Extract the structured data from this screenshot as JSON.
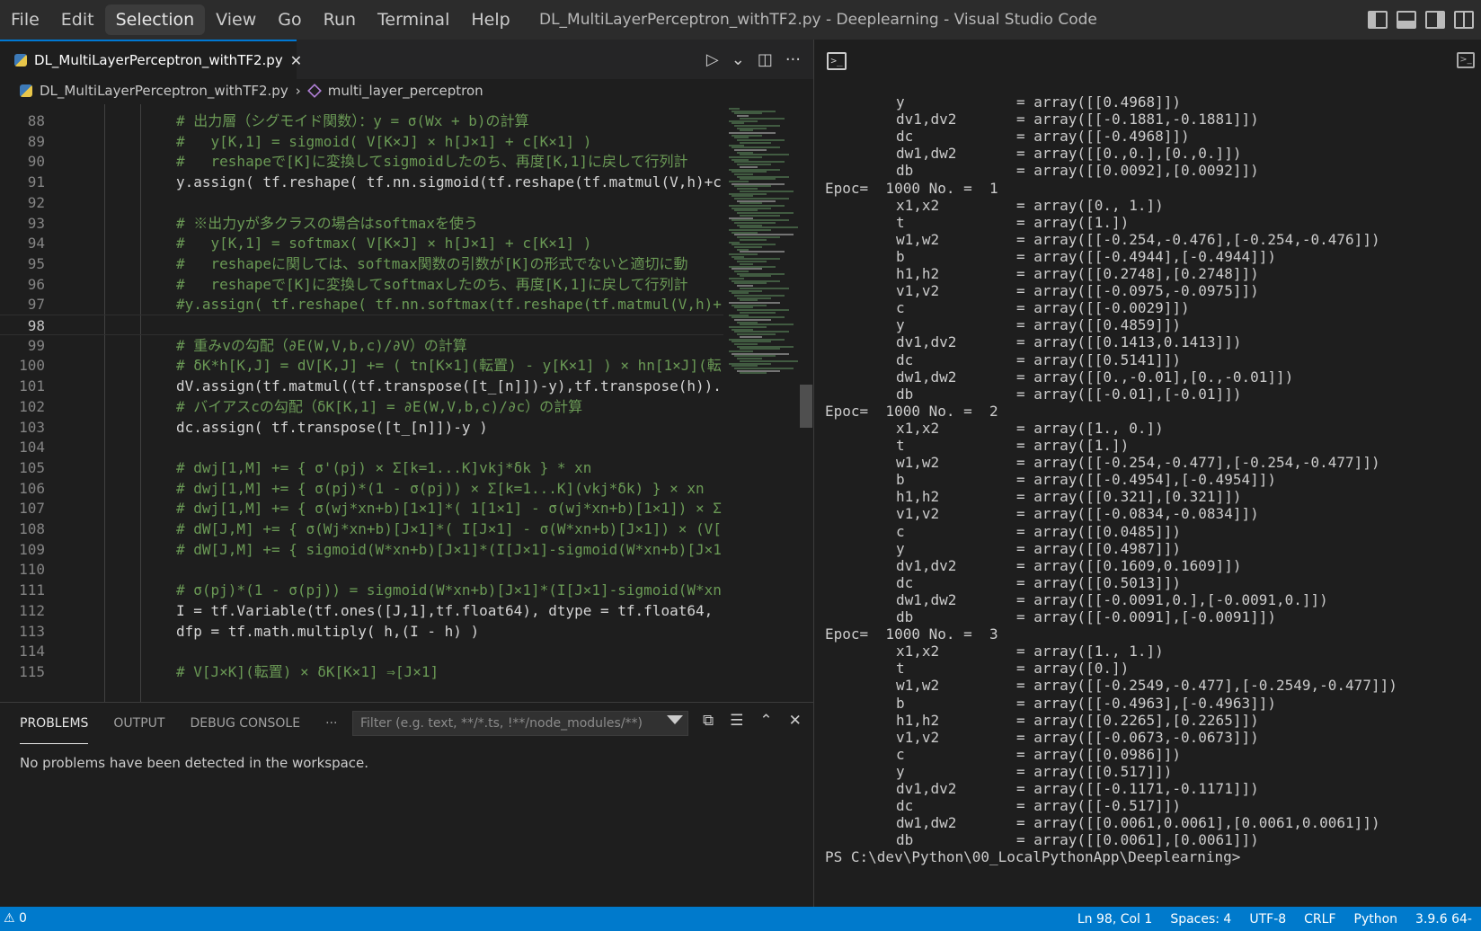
{
  "menu": [
    "File",
    "Edit",
    "Selection",
    "View",
    "Go",
    "Run",
    "Terminal",
    "Help"
  ],
  "window_title": "DL_MultiLayerPerceptron_withTF2.py - Deeplearning - Visual Studio Code",
  "tab": {
    "label": "DL_MultiLayerPerceptron_withTF2.py",
    "close": "✕"
  },
  "breadcrumb": {
    "file": "DL_MultiLayerPerceptron_withTF2.py",
    "sep": "›",
    "symbol": "multi_layer_perceptron"
  },
  "editor_actions": {
    "run": "▷",
    "run_menu": "⌄",
    "split": "◫",
    "more": "···"
  },
  "code_lines": [
    {
      "n": "88",
      "t": "# 出力層（シグモイド関数）：y = σ(Wx + b)の計算",
      "c": true
    },
    {
      "n": "89",
      "t": "#   y[K,1] = sigmoid( V[K×J] × h[J×1] + c[K×1] )",
      "c": true
    },
    {
      "n": "90",
      "t": "#   reshapeで[K]に変換してsigmoidしたのち、再度[K,1]に戻して行列計",
      "c": true
    },
    {
      "n": "91",
      "t": "y.assign( tf.reshape( tf.nn.sigmoid(tf.reshape(tf.matmul(V,h)+c",
      "c": false
    },
    {
      "n": "92",
      "t": "",
      "c": false
    },
    {
      "n": "93",
      "t": "# ※出力yが多クラスの場合はsoftmaxを使う",
      "c": true
    },
    {
      "n": "94",
      "t": "#   y[K,1] = softmax( V[K×J] × h[J×1] + c[K×1] )",
      "c": true
    },
    {
      "n": "95",
      "t": "#   reshapeに関しては、softmax関数の引数が[K]の形式でないと適切に動",
      "c": true
    },
    {
      "n": "96",
      "t": "#   reshapeで[K]に変換してsoftmaxしたのち、再度[K,1]に戻して行列計",
      "c": true
    },
    {
      "n": "97",
      "t": "#y.assign( tf.reshape( tf.nn.softmax(tf.reshape(tf.matmul(V,h)+",
      "c": true
    },
    {
      "n": "98",
      "t": "",
      "c": false
    },
    {
      "n": "99",
      "t": "# 重みvの勾配（∂E(W,V,b,c)/∂V）の計算",
      "c": true
    },
    {
      "n": "100",
      "t": "# δK*h[K,J] = dV[K,J] += ( tn[K×1](転置) - y[K×1] ) × hn[1×J](転",
      "c": true
    },
    {
      "n": "101",
      "t": "dV.assign(tf.matmul((tf.transpose([t_[n]])-y),tf.transpose(h)).",
      "c": false
    },
    {
      "n": "102",
      "t": "# バイアスcの勾配（δK[K,1] = ∂E(W,V,b,c)/∂c）の計算",
      "c": true
    },
    {
      "n": "103",
      "t": "dc.assign( tf.transpose([t_[n]])-y )",
      "c": false
    },
    {
      "n": "104",
      "t": "",
      "c": false
    },
    {
      "n": "105",
      "t": "# dwj[1,M] += { σ'(pj) × Σ[k=1...K]vkj*δk } * xn",
      "c": true
    },
    {
      "n": "106",
      "t": "# dwj[1,M] += { σ(pj)*(1 - σ(pj)) × Σ[k=1...K](vkj*δk) } × xn",
      "c": true
    },
    {
      "n": "107",
      "t": "# dwj[1,M] += { σ(wj*xn+b)[1×1]*( 1[1×1] - σ(wj*xn+b)[1×1]) × Σ",
      "c": true
    },
    {
      "n": "108",
      "t": "# dW[J,M] += { σ(Wj*xn+b)[J×1]*( I[J×1] - σ(W*xn+b)[J×1]) × (V[",
      "c": true
    },
    {
      "n": "109",
      "t": "# dW[J,M] += { sigmoid(W*xn+b)[J×1]*(I[J×1]-sigmoid(W*xn+b)[J×1",
      "c": true
    },
    {
      "n": "110",
      "t": "",
      "c": false
    },
    {
      "n": "111",
      "t": "# σ(pj)*(1 - σ(pj)) = sigmoid(W*xn+b)[J×1]*(I[J×1]-sigmoid(W*xn",
      "c": true
    },
    {
      "n": "112",
      "t": "I = tf.Variable(tf.ones([J,1],tf.float64), dtype = tf.float64,",
      "c": false
    },
    {
      "n": "113",
      "t": "dfp = tf.math.multiply( h,(I - h) )",
      "c": false
    },
    {
      "n": "114",
      "t": "",
      "c": false
    },
    {
      "n": "115",
      "t": "# V[J×K](転置) × δK[K×1] ⇒[J×1]",
      "c": true
    }
  ],
  "panel": {
    "tabs": [
      "PROBLEMS",
      "OUTPUT",
      "DEBUG CONSOLE"
    ],
    "more": "···",
    "filter_placeholder": "Filter (e.g. text, **/*.ts, !**/node_modules/**)",
    "actions": [
      "⧉",
      "☰",
      "⌃",
      "✕"
    ],
    "message": "No problems have been detected in the workspace."
  },
  "terminal_icon": ">_",
  "terminal_lines": [
    {
      "k": "y",
      "v": "= array([[0.4968]])"
    },
    {
      "k": "dv1,dv2",
      "v": "= array([[-0.1881,-0.1881]])"
    },
    {
      "k": "dc",
      "v": "= array([[-0.4968]])"
    },
    {
      "k": "dw1,dw2",
      "v": "= array([[0.,0.],[0.,0.]])"
    },
    {
      "k": "db",
      "v": "= array([[0.0092],[0.0092]])"
    },
    {
      "e": "Epoc=  1000 No. =  1"
    },
    {
      "k": "x1,x2",
      "v": "= array([0., 1.])"
    },
    {
      "k": "t",
      "v": "= array([1.])"
    },
    {
      "k": "w1,w2",
      "v": "= array([[-0.254,-0.476],[-0.254,-0.476]])"
    },
    {
      "k": "b",
      "v": "= array([[-0.4944],[-0.4944]])"
    },
    {
      "k": "h1,h2",
      "v": "= array([[0.2748],[0.2748]])"
    },
    {
      "k": "v1,v2",
      "v": "= array([[-0.0975,-0.0975]])"
    },
    {
      "k": "c",
      "v": "= array([[-0.0029]])"
    },
    {
      "k": "y",
      "v": "= array([[0.4859]])"
    },
    {
      "k": "dv1,dv2",
      "v": "= array([[0.1413,0.1413]])"
    },
    {
      "k": "dc",
      "v": "= array([[0.5141]])"
    },
    {
      "k": "dw1,dw2",
      "v": "= array([[0.,-0.01],[0.,-0.01]])"
    },
    {
      "k": "db",
      "v": "= array([[-0.01],[-0.01]])"
    },
    {
      "e": "Epoc=  1000 No. =  2"
    },
    {
      "k": "x1,x2",
      "v": "= array([1., 0.])"
    },
    {
      "k": "t",
      "v": "= array([1.])"
    },
    {
      "k": "w1,w2",
      "v": "= array([[-0.254,-0.477],[-0.254,-0.477]])"
    },
    {
      "k": "b",
      "v": "= array([[-0.4954],[-0.4954]])"
    },
    {
      "k": "h1,h2",
      "v": "= array([[0.321],[0.321]])"
    },
    {
      "k": "v1,v2",
      "v": "= array([[-0.0834,-0.0834]])"
    },
    {
      "k": "c",
      "v": "= array([[0.0485]])"
    },
    {
      "k": "y",
      "v": "= array([[0.4987]])"
    },
    {
      "k": "dv1,dv2",
      "v": "= array([[0.1609,0.1609]])"
    },
    {
      "k": "dc",
      "v": "= array([[0.5013]])"
    },
    {
      "k": "dw1,dw2",
      "v": "= array([[-0.0091,0.],[-0.0091,0.]])"
    },
    {
      "k": "db",
      "v": "= array([[-0.0091],[-0.0091]])"
    },
    {
      "e": "Epoc=  1000 No. =  3"
    },
    {
      "k": "x1,x2",
      "v": "= array([1., 1.])"
    },
    {
      "k": "t",
      "v": "= array([0.])"
    },
    {
      "k": "w1,w2",
      "v": "= array([[-0.2549,-0.477],[-0.2549,-0.477]])"
    },
    {
      "k": "b",
      "v": "= array([[-0.4963],[-0.4963]])"
    },
    {
      "k": "h1,h2",
      "v": "= array([[0.2265],[0.2265]])"
    },
    {
      "k": "v1,v2",
      "v": "= array([[-0.0673,-0.0673]])"
    },
    {
      "k": "c",
      "v": "= array([[0.0986]])"
    },
    {
      "k": "y",
      "v": "= array([[0.517]])"
    },
    {
      "k": "dv1,dv2",
      "v": "= array([[-0.1171,-0.1171]])"
    },
    {
      "k": "dc",
      "v": "= array([[-0.517]])"
    },
    {
      "k": "dw1,dw2",
      "v": "= array([[0.0061,0.0061],[0.0061,0.0061]])"
    },
    {
      "k": "db",
      "v": "= array([[0.0061],[0.0061]])"
    },
    {
      "e": "PS C:\\dev\\Python\\00_LocalPythonApp\\Deeplearning>"
    }
  ],
  "status": {
    "left": "⚠ 0",
    "right": [
      "Ln 98, Col 1",
      "Spaces: 4",
      "UTF-8",
      "CRLF",
      "Python",
      "3.9.6 64-"
    ]
  },
  "colors": {
    "accent": "#007acc",
    "comment": "#6a9955",
    "code": "#d4d4d4"
  }
}
